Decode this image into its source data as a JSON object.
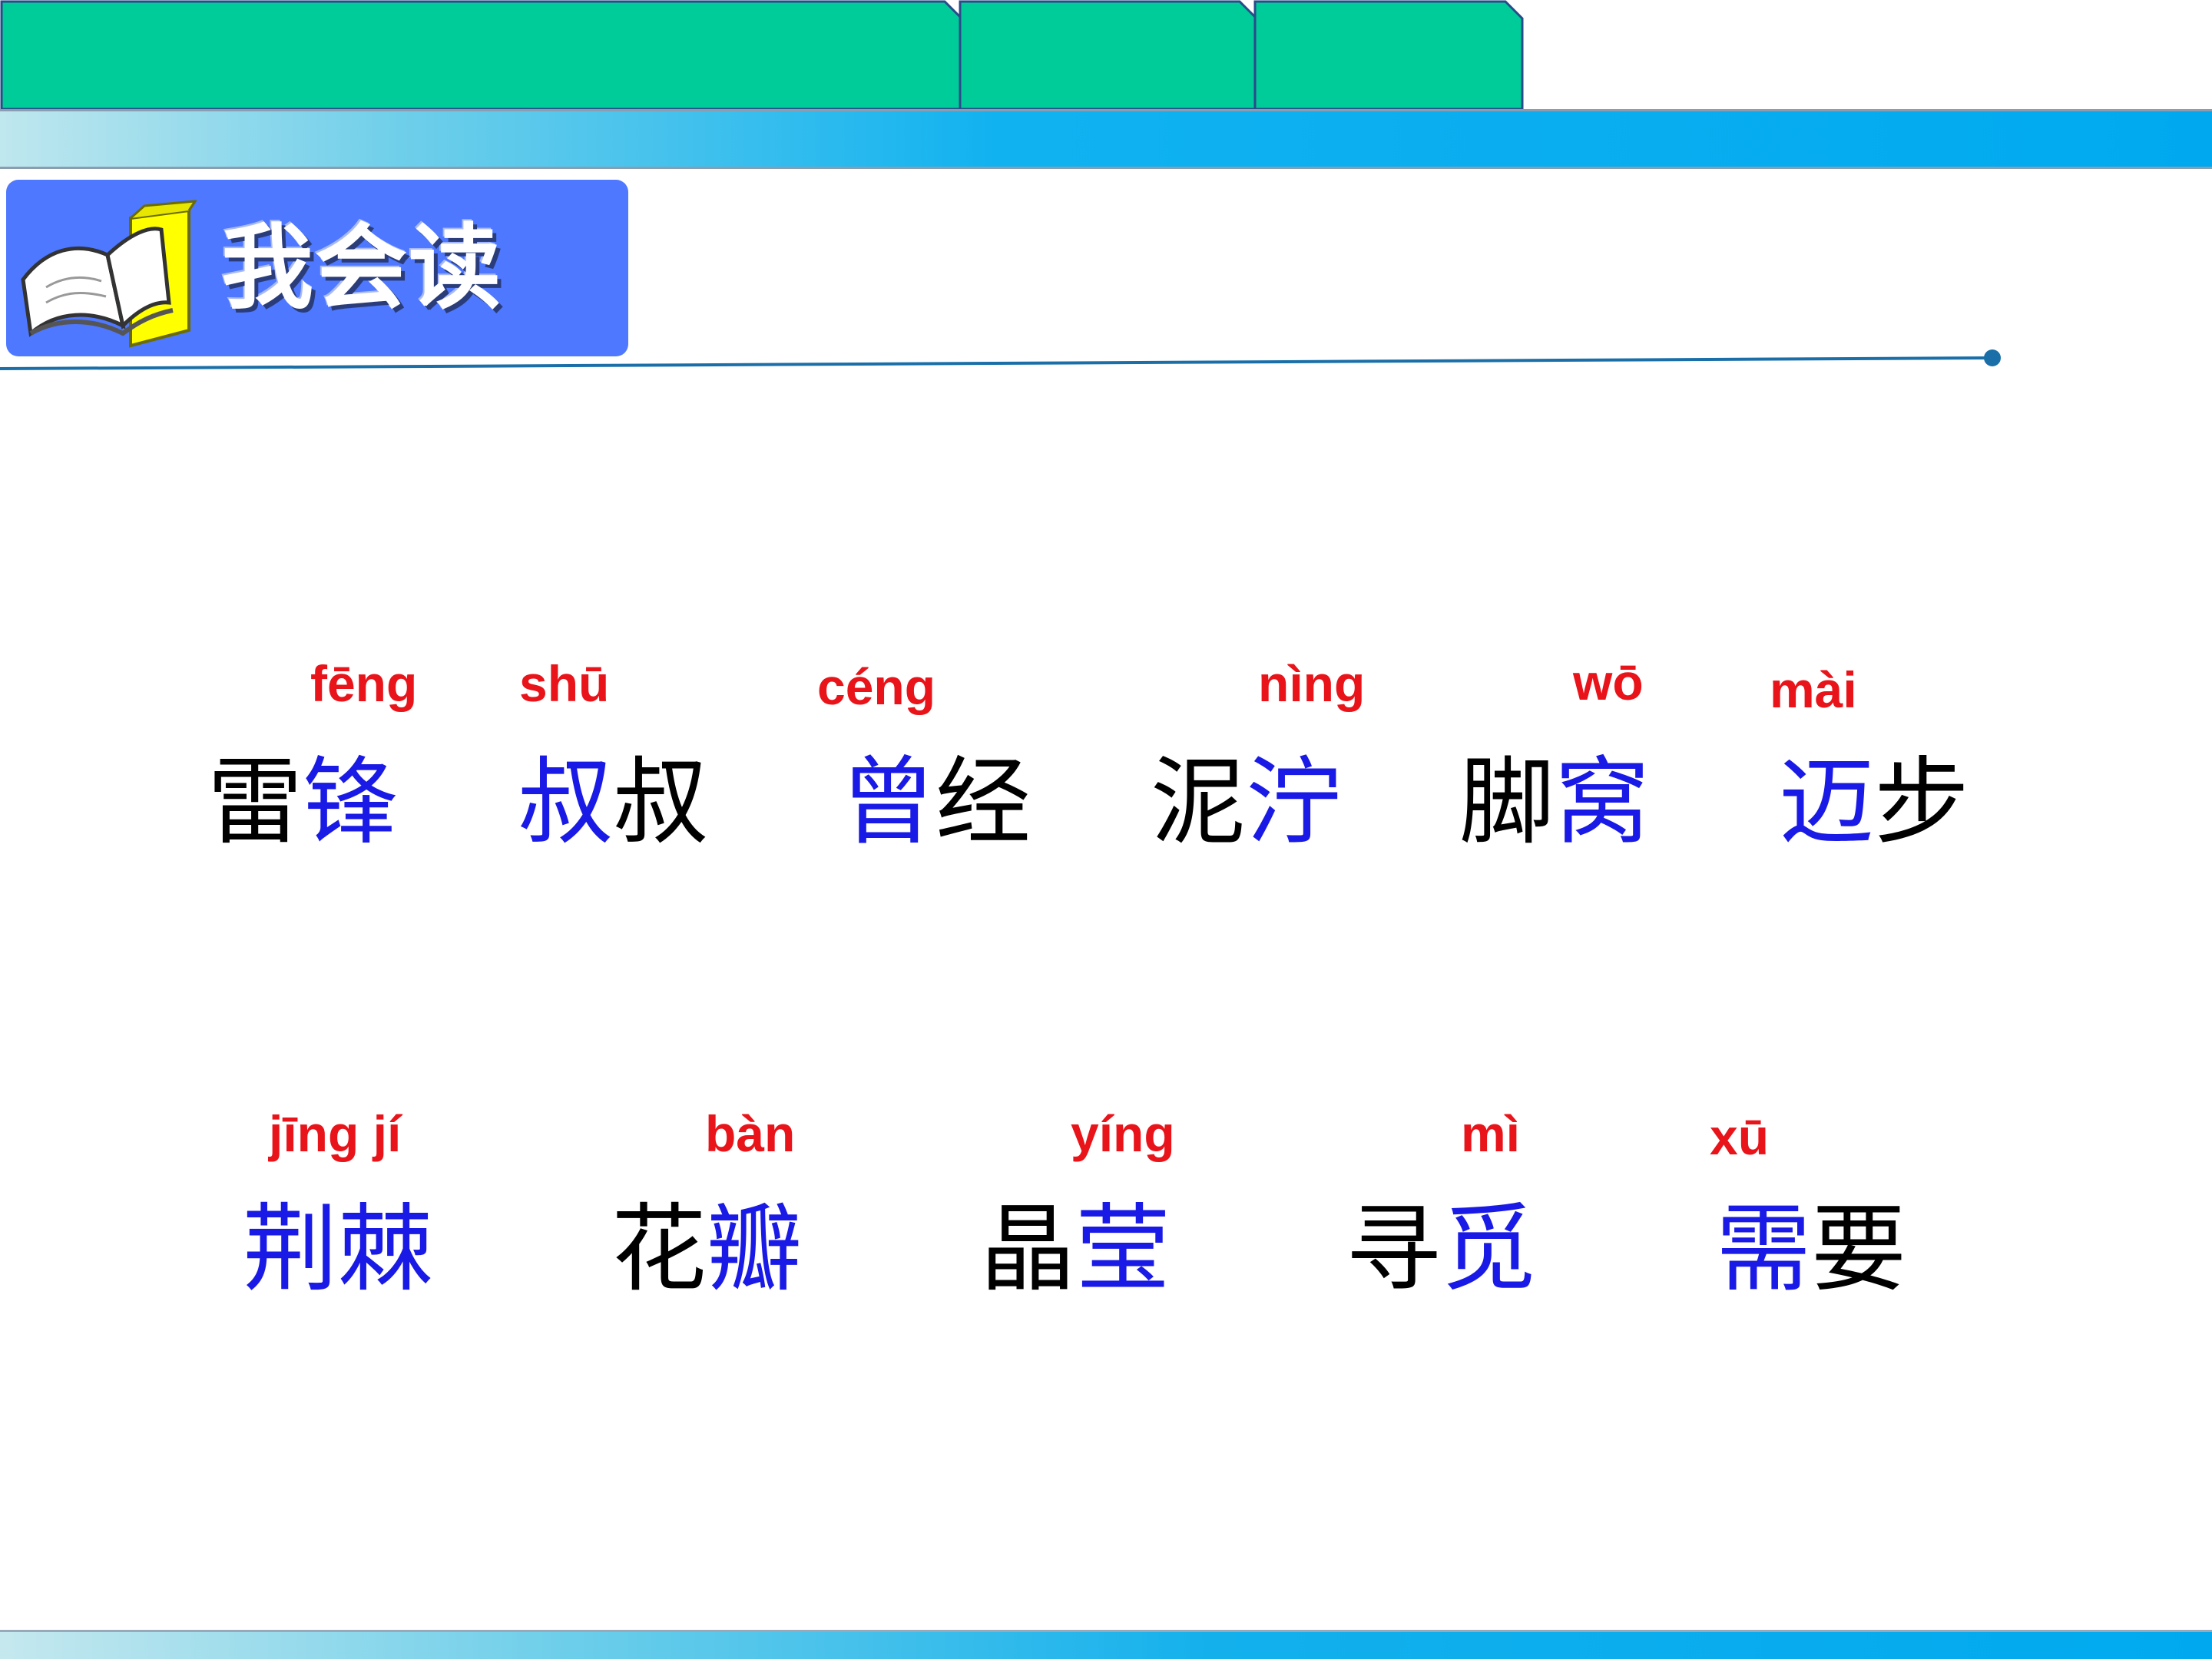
{
  "section_title": "我会读",
  "colors": {
    "pinyin": "#e8141a",
    "target_char": "#1a1ae6",
    "normal_char": "#000000",
    "tab_green": "#00cc99",
    "title_bg": "#4d78ff"
  },
  "icons": {
    "section": "open-book-icon"
  },
  "rows": [
    [
      {
        "id": "leifeng",
        "pinyin": "fēng",
        "chars": [
          {
            "c": "雷",
            "hl": false
          },
          {
            "c": "锋",
            "hl": true
          }
        ]
      },
      {
        "id": "shushu",
        "pinyin": "shū",
        "chars": [
          {
            "c": "叔",
            "hl": true
          },
          {
            "c": "叔",
            "hl": false
          }
        ]
      },
      {
        "id": "cengjing",
        "pinyin": "céng",
        "chars": [
          {
            "c": "曾",
            "hl": true
          },
          {
            "c": "经",
            "hl": false
          }
        ]
      },
      {
        "id": "nining",
        "pinyin": "nìng",
        "chars": [
          {
            "c": "泥",
            "hl": false
          },
          {
            "c": "泞",
            "hl": true
          }
        ]
      },
      {
        "id": "jiaowo",
        "pinyin": "wō",
        "chars": [
          {
            "c": "脚",
            "hl": false
          },
          {
            "c": "窝",
            "hl": true
          }
        ]
      },
      {
        "id": "maibu",
        "pinyin": "mài",
        "chars": [
          {
            "c": "迈",
            "hl": true
          },
          {
            "c": "步",
            "hl": false
          }
        ]
      }
    ],
    [
      {
        "id": "jingji",
        "pinyin": "jīng jí",
        "chars": [
          {
            "c": "荆",
            "hl": true
          },
          {
            "c": "棘",
            "hl": true
          }
        ]
      },
      {
        "id": "huaban",
        "pinyin": "bàn",
        "chars": [
          {
            "c": "花",
            "hl": false
          },
          {
            "c": "瓣",
            "hl": true
          }
        ]
      },
      {
        "id": "jingying",
        "pinyin": "yíng",
        "chars": [
          {
            "c": "晶",
            "hl": false
          },
          {
            "c": "莹",
            "hl": true
          }
        ]
      },
      {
        "id": "xunmi",
        "pinyin": "mì",
        "chars": [
          {
            "c": "寻",
            "hl": false
          },
          {
            "c": "觅",
            "hl": true
          }
        ]
      },
      {
        "id": "xuyao",
        "pinyin": "xū",
        "chars": [
          {
            "c": "需",
            "hl": true
          },
          {
            "c": "要",
            "hl": false
          }
        ]
      }
    ]
  ]
}
